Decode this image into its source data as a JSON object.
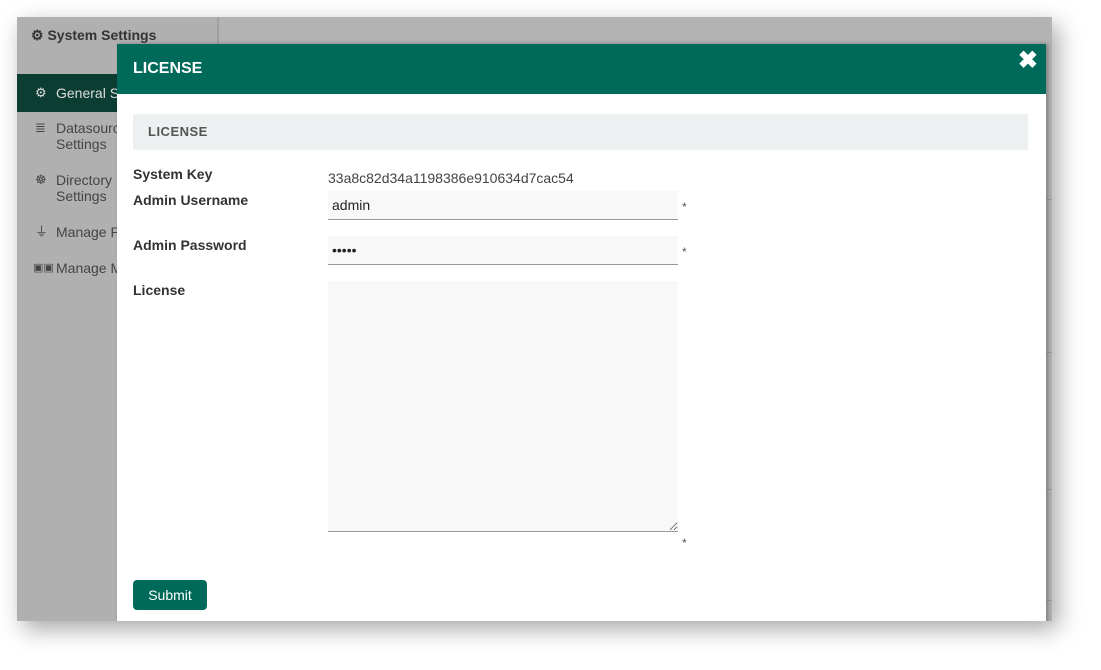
{
  "sidebar": {
    "title": "System Settings",
    "items": [
      {
        "label": "General S",
        "icon": "gear-icon"
      },
      {
        "label": "Datasourc",
        "label2": "Settings",
        "icon": "database-icon"
      },
      {
        "label": "Directory",
        "label2": "Settings",
        "icon": "users-gear-icon"
      },
      {
        "label": "Manage P",
        "icon": "plug-icon"
      },
      {
        "label": "Manage M",
        "icon": "id-card-icon"
      }
    ]
  },
  "modal": {
    "title": "LICENSE",
    "section": "LICENSE",
    "system_key_label": "System Key",
    "system_key": "33a8c82d34a1198386e910634d7cac54",
    "username_label": "Admin Username",
    "username": "admin",
    "password_label": "Admin Password",
    "password": "admin",
    "license_label": "License",
    "license": "",
    "required_mark": "*",
    "submit": "Submit"
  },
  "colors": {
    "accent": "#006a5a",
    "active_sidebar": "#0c3d33"
  }
}
